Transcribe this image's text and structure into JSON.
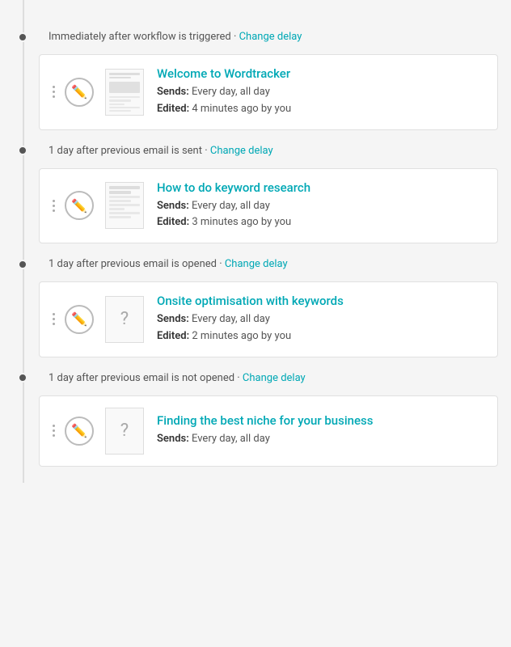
{
  "workflow": {
    "steps": [
      {
        "id": "step1",
        "delay_text": "Immediately after workflow is triggered",
        "delay_separator": " · ",
        "delay_link": "Change delay",
        "email": {
          "title": "Welcome to Wordtracker",
          "sends": "Every day, all day",
          "edited": "4 minutes ago by you",
          "thumbnail_type": "content"
        }
      },
      {
        "id": "step2",
        "delay_text": "1 day after previous email is sent",
        "delay_separator": " · ",
        "delay_link": "Change delay",
        "email": {
          "title": "How to do keyword research",
          "sends": "Every day, all day",
          "edited": "3 minutes ago by you",
          "thumbnail_type": "content"
        }
      },
      {
        "id": "step3",
        "delay_text": "1 day after previous email is opened",
        "delay_separator": " · ",
        "delay_link": "Change delay",
        "email": {
          "title": "Onsite optimisation with keywords",
          "sends": "Every day, all day",
          "edited": "2 minutes ago by you",
          "thumbnail_type": "question"
        }
      },
      {
        "id": "step4",
        "delay_text": "1 day after previous email is not opened",
        "delay_separator": " · ",
        "delay_link": "Change delay",
        "email": {
          "title": "Finding the best niche for your business",
          "sends": "Every day, all day",
          "edited": null,
          "thumbnail_type": "question"
        }
      }
    ],
    "labels": {
      "sends_label": "Sends:",
      "edited_label": "Edited:"
    }
  }
}
